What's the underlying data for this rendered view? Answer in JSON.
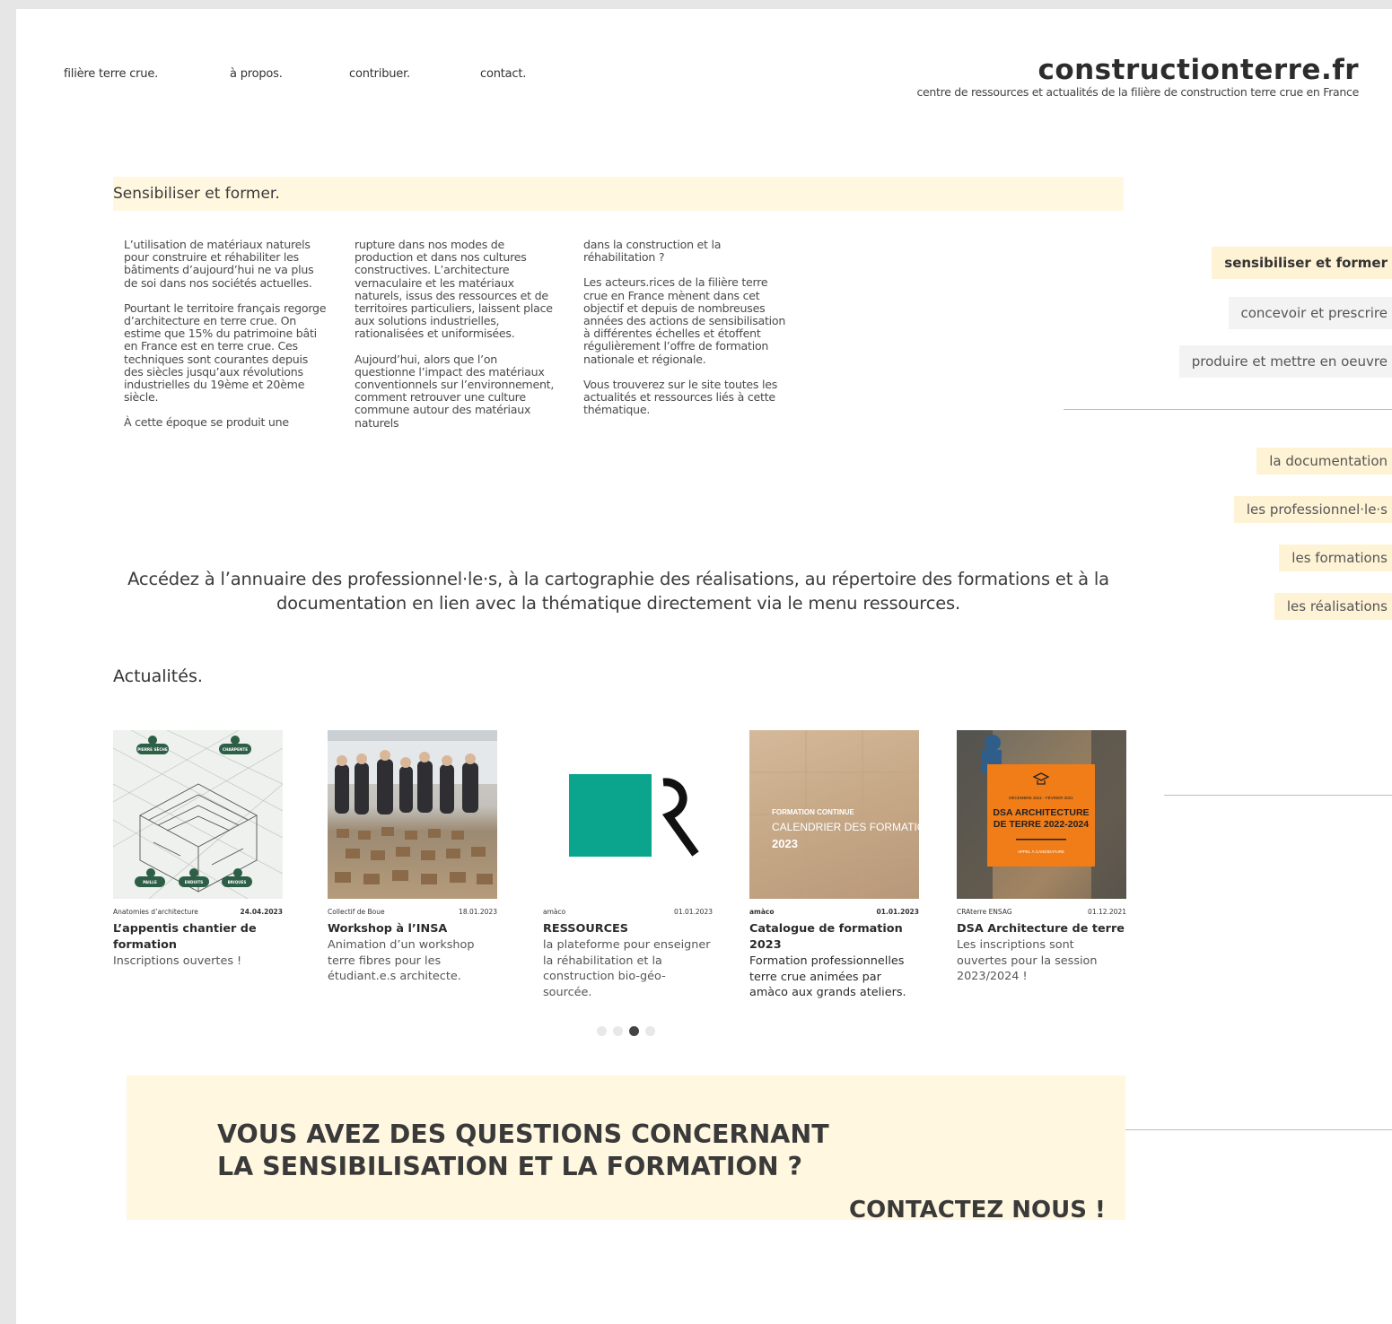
{
  "nav": {
    "items": [
      "filière terre crue.",
      "à propos.",
      "contribuer.",
      "contact."
    ]
  },
  "brand": {
    "title": "constructionterre.fr",
    "subtitle": "centre de ressources et actualités de la filière de construction terre crue en France"
  },
  "section": {
    "title": "Sensibiliser et former."
  },
  "intro": {
    "col1": [
      "L’utilisation de matériaux naturels pour construire et réhabiliter les bâtiments d’aujourd’hui ne va plus de soi dans nos sociétés actuelles.",
      "Pourtant le territoire français regorge d’architecture en terre crue. On estime que 15% du patrimoine bâti en France est en terre crue. Ces techniques sont courantes depuis des siècles jusqu’aux révolutions industrielles du 19ème et 20ème siècle.",
      "À cette époque se produit une"
    ],
    "col2": [
      "rupture dans nos modes de production et dans nos cultures constructives. L’architecture vernaculaire et les matériaux naturels, issus des ressources et de territoires particuliers, laissent place aux solutions industrielles, rationalisées et uniformisées.",
      "Aujourd’hui, alors que l’on questionne l’impact des matériaux conventionnels sur l’environnement, comment retrouver une culture commune autour des matériaux naturels"
    ],
    "col3": [
      "dans la construction et la réhabilitation ?",
      "Les acteurs.rices de la filière terre crue en France mènent dans cet objectif et depuis de nombreuses années des actions de sensibilisation à différentes échelles et étoffent régulièrement l’offre de formation nationale et régionale.",
      "Vous trouverez sur le site toutes les actualités et ressources liés à cette thématique."
    ]
  },
  "right_menu": {
    "themes": [
      "sensibiliser et former",
      "concevoir et prescrire",
      "produire et mettre en oeuvre"
    ],
    "resources": [
      "la documentation",
      "les professionnel·le·s",
      "les formations",
      "les réalisations"
    ]
  },
  "access_text": "Accédez à l’annuaire des professionnel·le·s, à la cartographie des réalisations, au répertoire des formations et à la documentation en lien avec la thématique directement via le menu ressources.",
  "news": {
    "title": "Actualités.",
    "cards": [
      {
        "source": "Anatomies d’architecture",
        "date": "24.04.2023",
        "title": "L’appentis chantier de formation",
        "desc": "Inscriptions ouvertes !"
      },
      {
        "source": "Collectif de Boue",
        "date": "18.01.2023",
        "title": "Workshop à l’INSA",
        "desc": "Animation d’un workshop terre fibres pour les étudiant.e.s architecte."
      },
      {
        "source": "amàco",
        "date": "01.01.2023",
        "title": "RESSOURCES",
        "desc": "la plateforme pour enseigner la réhabilitation et la construction bio-géo-sourcée."
      },
      {
        "source": "amàco",
        "date": "01.01.2023",
        "title": "Catalogue de formation 2023",
        "desc": "Formation professionnelles terre crue animées par amàco aux grands ateliers."
      },
      {
        "source": "CRAterre ENSAG",
        "date": "01.12.2021",
        "title": "DSA Architecture de terre",
        "desc": "Les inscriptions sont ouvertes pour la session 2023/2024 !"
      }
    ],
    "img_labels": {
      "c1": [
        "PIERRE SÈCHE",
        "CHARPENTE",
        "PAILLE",
        "ENDUITS",
        "BRIQUES"
      ],
      "c4": [
        "FORMATION CONTINUE",
        "CALENDRIER DES FORMATIONS",
        "2023"
      ],
      "c5": [
        "DÉCEMBRE 2021 - FÉVRIER 2021",
        "DSA ARCHITECTURE",
        "DE TERRE 2022-2024",
        "APPEL À CANDIDATURE"
      ]
    },
    "carousel": {
      "count": 4,
      "active": 3
    }
  },
  "questions": {
    "line1": "VOUS AVEZ DES QUESTIONS CONCERNANT",
    "line2": "LA SENSIBILISATION ET LA FORMATION ?",
    "cta": "CONTACTEZ NOUS !"
  },
  "colors": {
    "accent_bg": "#fff7df",
    "grey_bg": "#f3f3f3",
    "teal": "#0aa58c",
    "orange": "#f07d18"
  }
}
